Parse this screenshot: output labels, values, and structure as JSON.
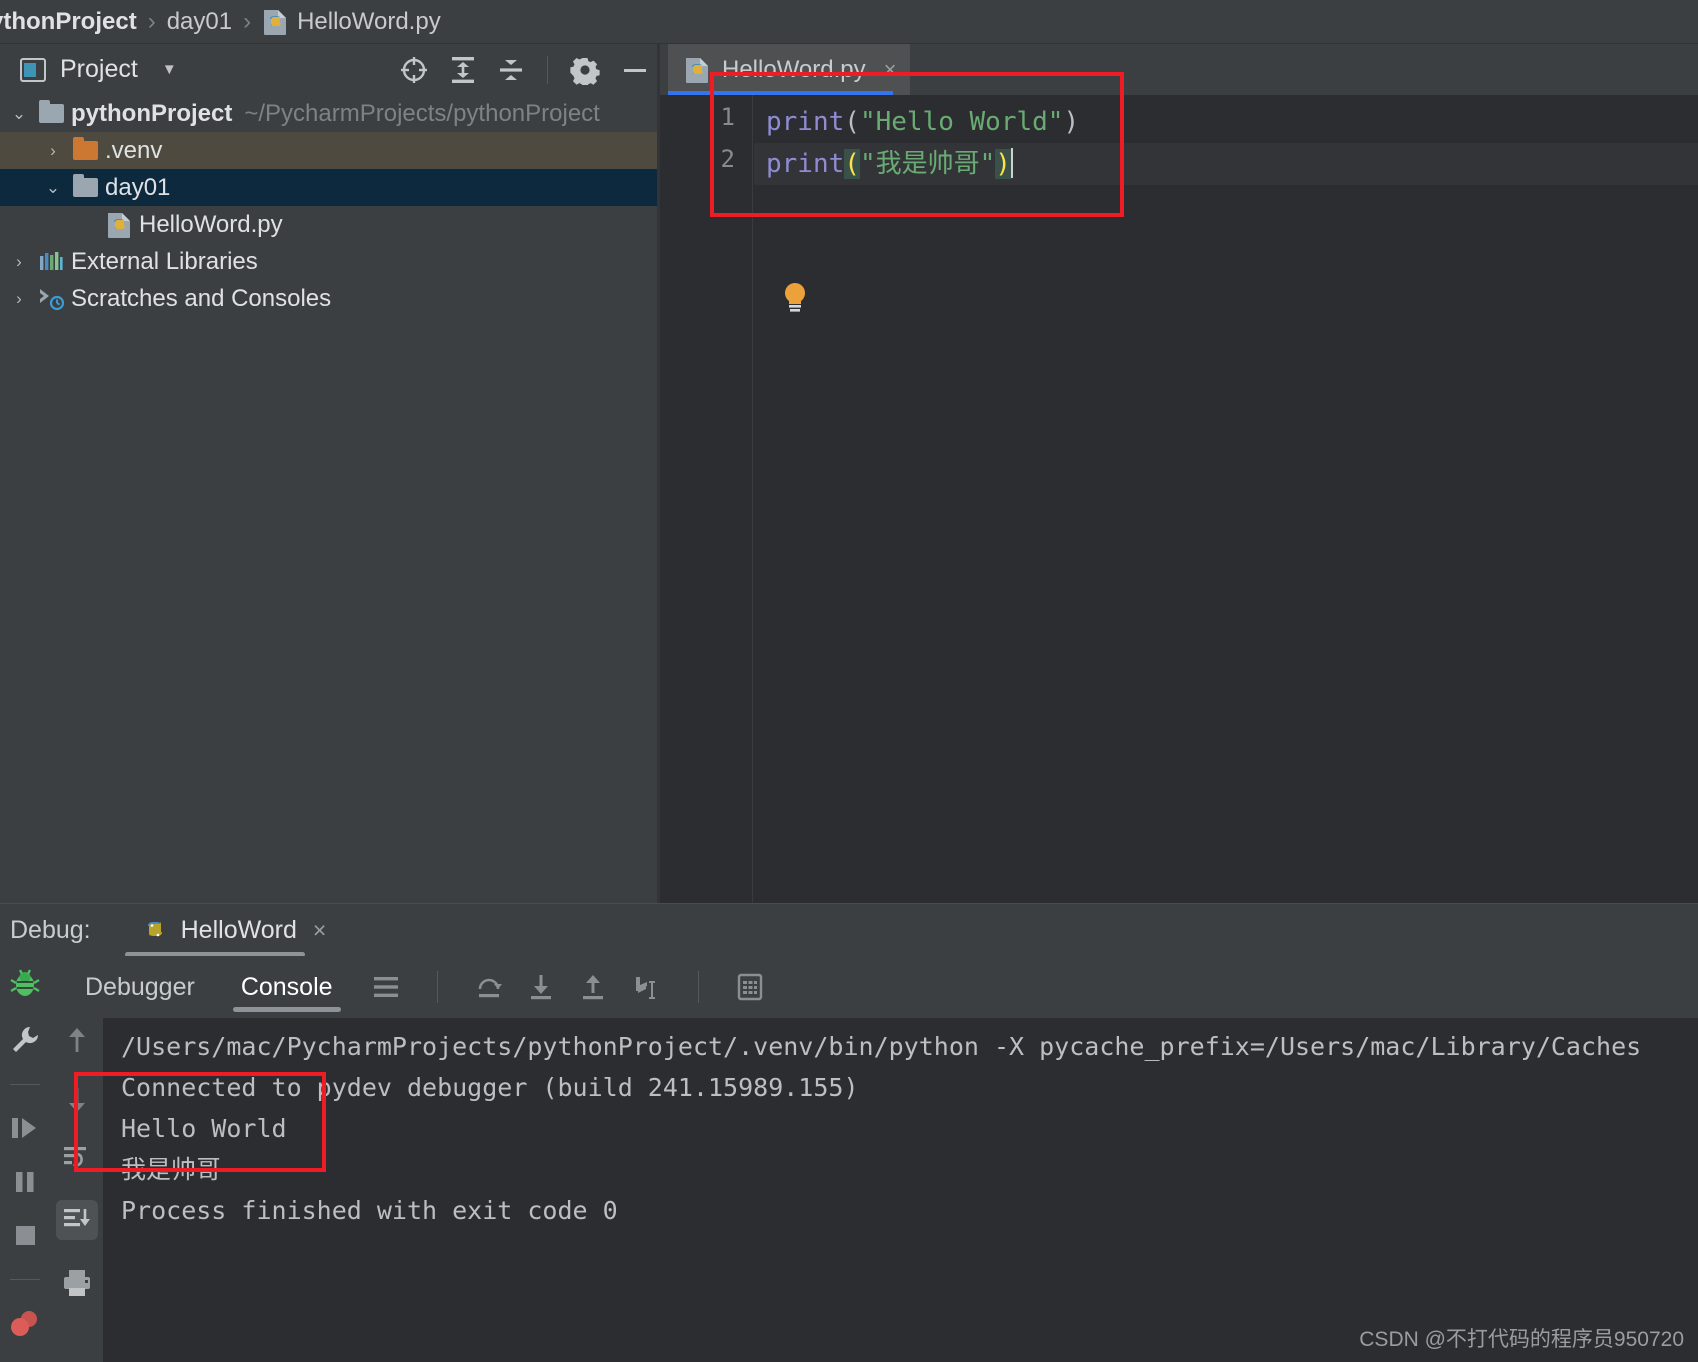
{
  "breadcrumb": {
    "items": [
      {
        "label": "ythonProject",
        "icon": "",
        "bold": true
      },
      {
        "label": "day01",
        "icon": "",
        "bold": false
      },
      {
        "label": "HelloWord.py",
        "icon": "python-file-icon",
        "bold": false
      }
    ],
    "separator": "›"
  },
  "project_toolwindow": {
    "title": "Project",
    "title_icon": "project-window-icon",
    "caret": "▼",
    "actions": [
      {
        "name": "select-opened-file-icon",
        "tooltip": "Select Opened File"
      },
      {
        "name": "expand-all-icon",
        "tooltip": "Expand All"
      },
      {
        "name": "collapse-all-icon",
        "tooltip": "Collapse All"
      },
      {
        "name": "settings-gear-icon",
        "tooltip": "Options"
      },
      {
        "name": "hide-icon",
        "tooltip": "Hide"
      }
    ]
  },
  "tree": {
    "rows": [
      {
        "arrow": "⌄",
        "expanded": true,
        "icon": "folder-icon",
        "label": "pythonProject",
        "bold": true,
        "sub": "~/PycharmProjects/pythonProject",
        "indent": 0,
        "state": "normal"
      },
      {
        "arrow": "›",
        "expanded": false,
        "icon": "folder-icon-orange",
        "label": ".venv",
        "bold": false,
        "sub": "",
        "indent": 1,
        "state": "hovered"
      },
      {
        "arrow": "⌄",
        "expanded": true,
        "icon": "folder-icon",
        "label": "day01",
        "bold": false,
        "sub": "",
        "indent": 1,
        "state": "selected"
      },
      {
        "arrow": "",
        "expanded": false,
        "icon": "python-file-icon",
        "label": "HelloWord.py",
        "bold": false,
        "sub": "",
        "indent": 2,
        "state": "normal"
      },
      {
        "arrow": "›",
        "expanded": false,
        "icon": "external-libraries-icon",
        "label": "External Libraries",
        "bold": false,
        "sub": "",
        "indent": 0,
        "state": "normal"
      },
      {
        "arrow": "›",
        "expanded": false,
        "icon": "scratches-icon",
        "label": "Scratches and Consoles",
        "bold": false,
        "sub": "",
        "indent": 0,
        "state": "normal"
      }
    ]
  },
  "editor": {
    "tab": {
      "label": "HelloWord.py",
      "icon": "python-file-icon",
      "close": "×"
    },
    "line_numbers": [
      "1",
      "2"
    ],
    "code": {
      "line1": {
        "fn": "print",
        "open": "(",
        "string": "\"Hello World\"",
        "close": ")"
      },
      "line2": {
        "fn": "print",
        "open": "(",
        "string": "\"我是帅哥\"",
        "close": ")"
      }
    },
    "intention_bulb": "lightbulb-icon"
  },
  "debug": {
    "label": "Debug:",
    "run_config": {
      "name": "HelloWord",
      "icon": "python-icon",
      "close": "×"
    },
    "left_rail": [
      {
        "name": "debug-bug-icon"
      },
      {
        "name": "wrench-icon"
      },
      {
        "name": "resume-program-icon"
      },
      {
        "name": "pause-program-icon"
      },
      {
        "name": "stop-program-icon"
      },
      {
        "name": "breakpoints-icon"
      }
    ],
    "tabs": [
      {
        "label": "Debugger",
        "active": false
      },
      {
        "label": "Console",
        "active": true
      }
    ],
    "toolbar_icons": [
      {
        "name": "frames-list-icon"
      },
      {
        "name": "step-over-icon"
      },
      {
        "name": "step-into-icon"
      },
      {
        "name": "step-out-icon"
      },
      {
        "name": "run-to-cursor-icon"
      },
      {
        "name": "evaluate-expression-icon"
      }
    ],
    "console_rail": [
      {
        "name": "scroll-up-icon",
        "selected": false
      },
      {
        "name": "scroll-down-icon",
        "selected": false
      },
      {
        "name": "soft-wrap-icon",
        "selected": false
      },
      {
        "name": "scroll-to-end-icon",
        "selected": true
      },
      {
        "name": "print-icon",
        "selected": false
      }
    ],
    "console_lines": [
      "/Users/mac/PycharmProjects/pythonProject/.venv/bin/python -X pycache_prefix=/Users/mac/Library/Caches",
      "Connected to pydev debugger (build 241.15989.155)",
      "Hello World",
      "我是帅哥",
      "",
      "Process finished with exit code 0"
    ]
  },
  "annotations": [
    {
      "name": "editor-code-highlight-box",
      "color": "#ee1c25"
    },
    {
      "name": "console-output-highlight-box",
      "color": "#ee1c25"
    }
  ],
  "watermark": "CSDN @不打代码的程序员950720",
  "colors": {
    "accent_blue": "#3574f0",
    "annotation_red": "#ee1c25",
    "editor_bg": "#2b2d30",
    "panel_bg": "#3c3f41",
    "selection_blue": "#0d293e",
    "hover_olive": "#4e4a3f",
    "string_green": "#6aab73",
    "function_purple": "#8f8cd4"
  }
}
